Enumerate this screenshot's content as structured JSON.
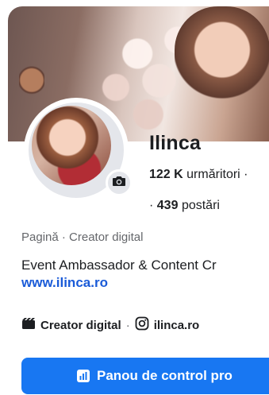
{
  "profile": {
    "name": "Ilinca",
    "followers_count": "122 K",
    "followers_label": "urmăritori ·",
    "posts_prefix": "·",
    "posts_count": "439",
    "posts_label": "postări"
  },
  "page_info": {
    "category": "Pagină · Creator digital",
    "bio": "Event Ambassador & Content Cr",
    "website": "www.ilinca.ro"
  },
  "details_row": {
    "category_label": "Creator digital",
    "separator": "·",
    "instagram_handle": "ilinca.ro"
  },
  "actions": {
    "dashboard_label": "Panou de control pro"
  },
  "icons": {
    "camera": "camera-icon",
    "clapper": "clapperboard-icon",
    "instagram": "instagram-icon",
    "dashboard": "dashboard-icon"
  },
  "colors": {
    "accent": "#1877f2",
    "link": "#1a5bd8",
    "muted": "#65676b"
  }
}
